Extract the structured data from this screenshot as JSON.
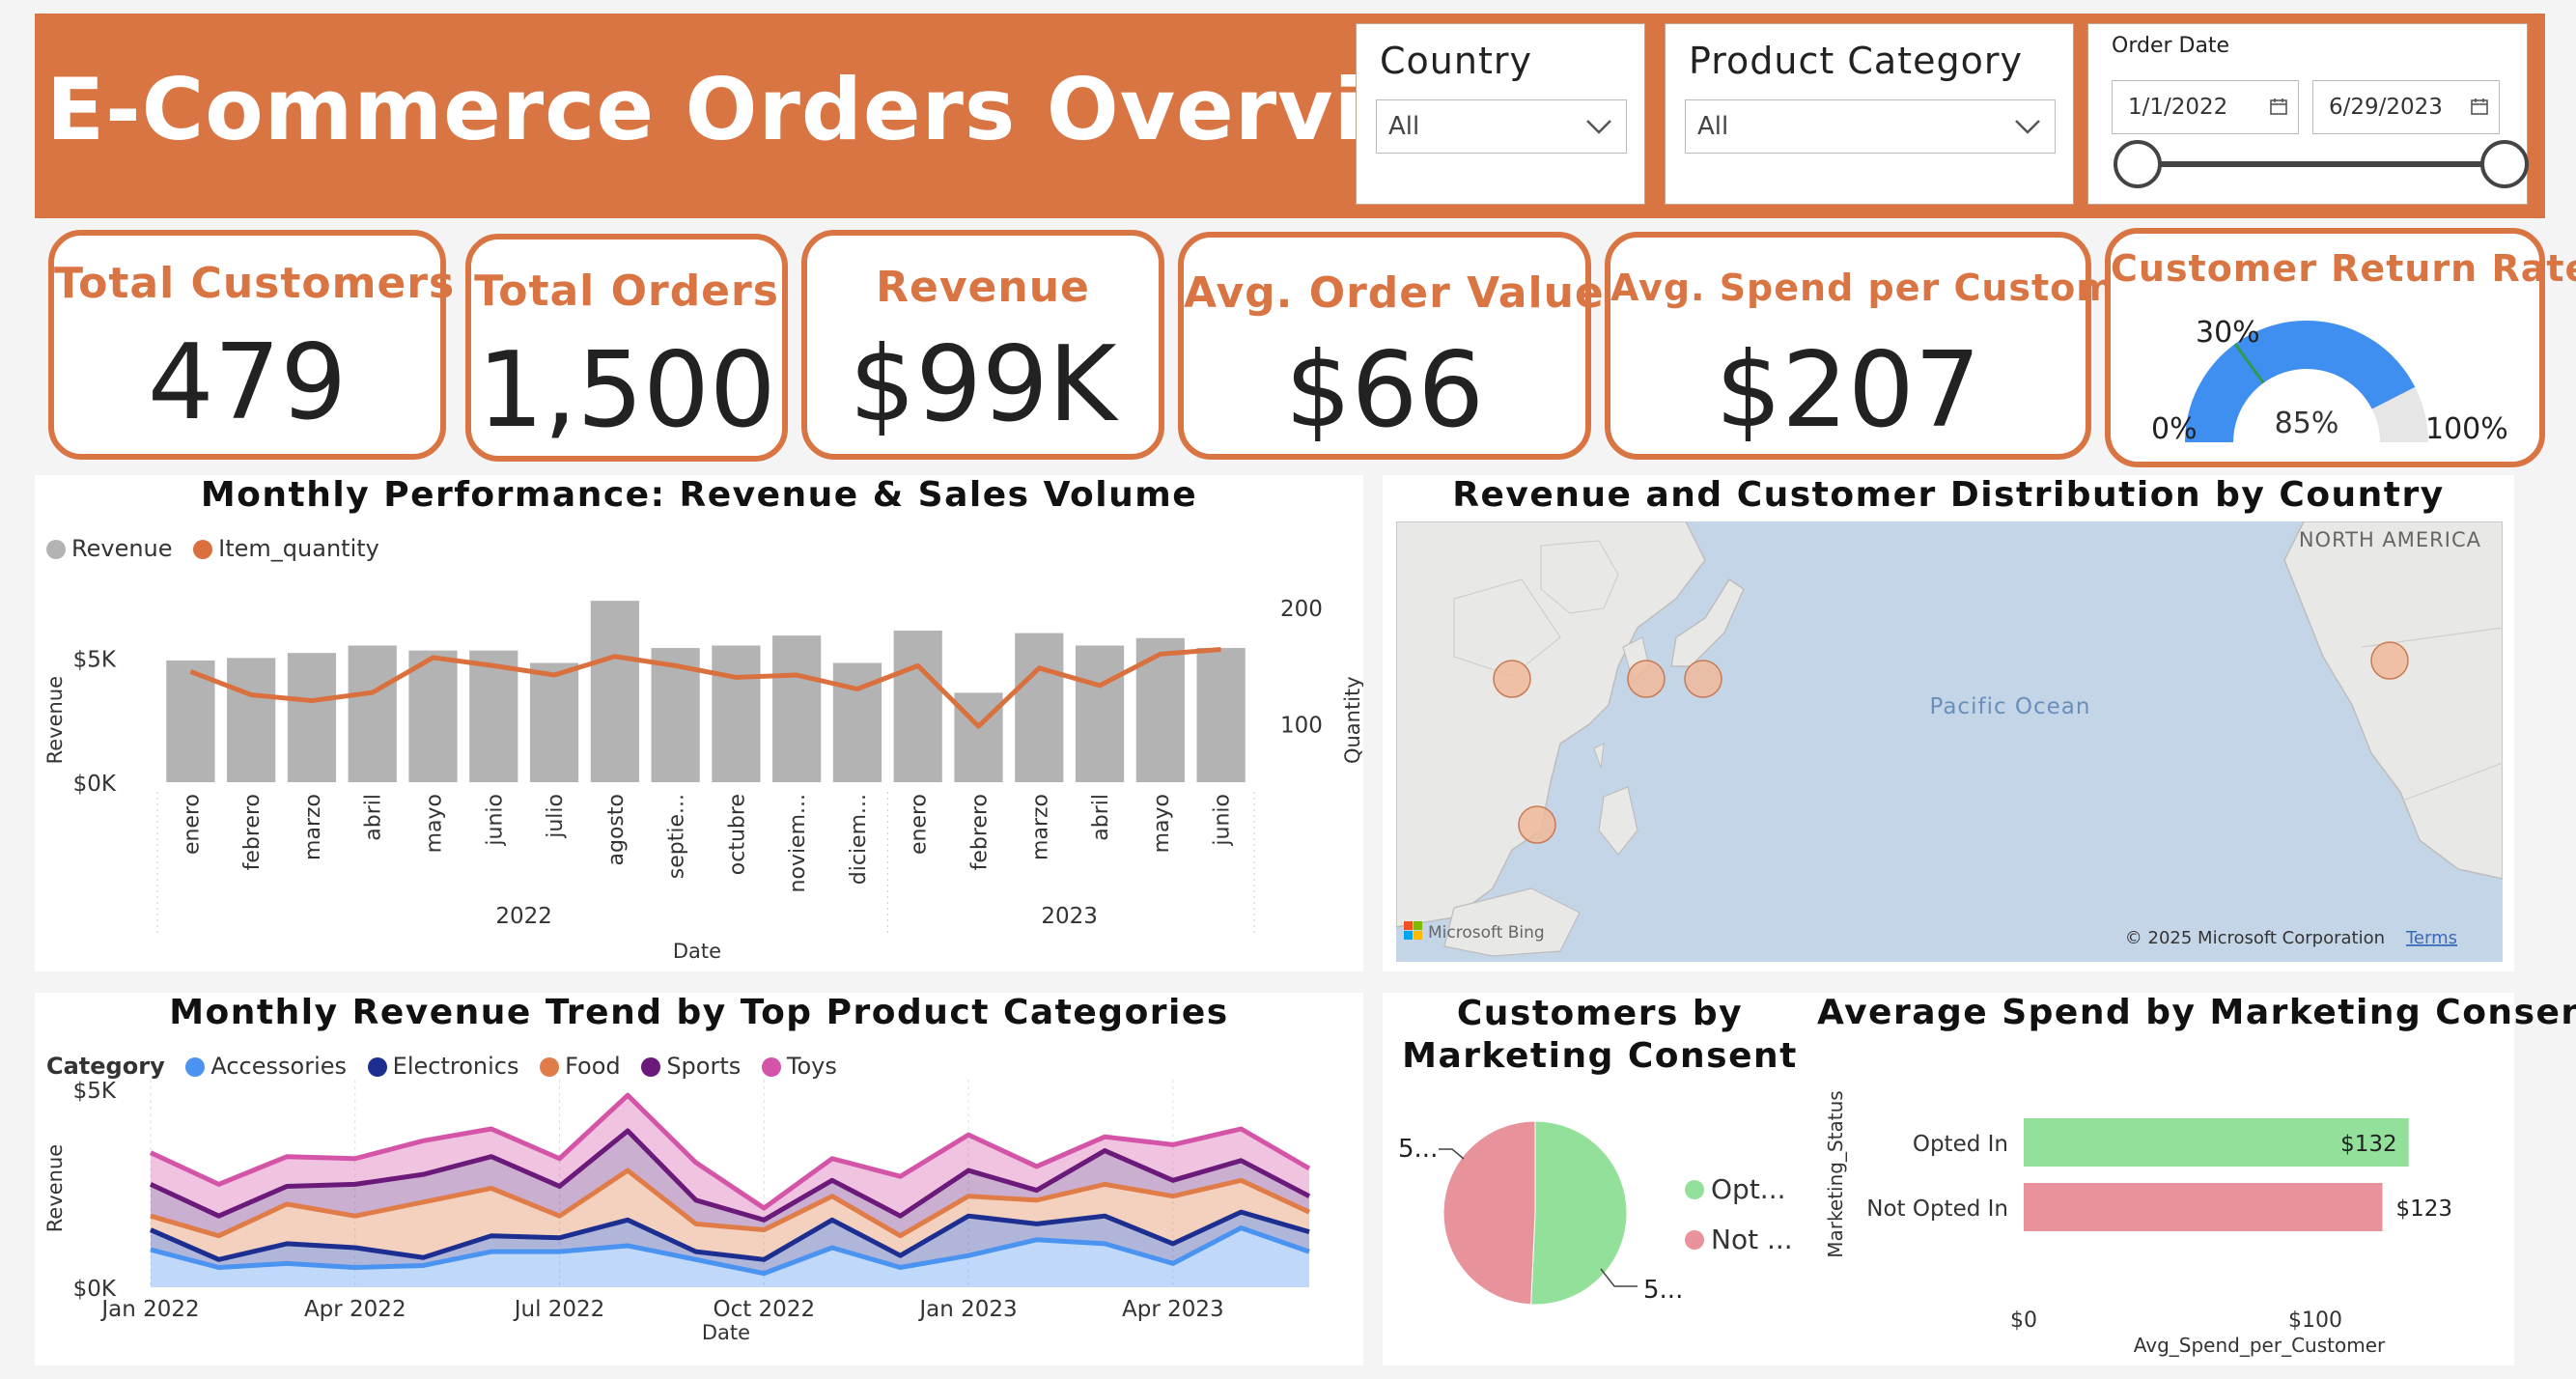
{
  "header": {
    "title": "E-Commerce Orders Overview",
    "country": {
      "label": "Country",
      "value": "All"
    },
    "category": {
      "label": "Product Category",
      "value": "All"
    },
    "order_date": {
      "label": "Order Date",
      "start": "1/1/2022",
      "end": "6/29/2023",
      "slider_start": 0,
      "slider_end": 1
    }
  },
  "kpis": {
    "customers": {
      "label": "Total Customers",
      "value": "479"
    },
    "orders": {
      "label": "Total Orders",
      "value": "1,500"
    },
    "revenue": {
      "label": "Revenue",
      "value": "$99K"
    },
    "aov": {
      "label": "Avg. Order Value",
      "value": "$66"
    },
    "spend": {
      "label": "Avg. Spend per Customer",
      "value": "$207"
    },
    "return_rate": {
      "label": "Customer Return Rate",
      "value": "85%",
      "min": "0%",
      "max": "100%",
      "target_label": "30%",
      "value_num": 85,
      "target_num": 30
    }
  },
  "colors": {
    "accent": "#d97443",
    "bar": "#b3b3b3",
    "line": "#d9703e",
    "accessories": "#4b93f0",
    "electronics": "#1d2e91",
    "food": "#e07c47",
    "sports": "#6b1a7a",
    "toys": "#d454a8",
    "opted_in": "#93e09a",
    "not_opted_in": "#e8929c",
    "gauge": "#3f8ff0",
    "map_water": "#c5d5e8",
    "map_land": "#eaeaea",
    "bubble": "#f0b89a"
  },
  "monthly_perf": {
    "title": "Monthly Performance: Revenue & Sales Volume",
    "legend": [
      "Revenue",
      "Item_quantity"
    ],
    "y_left_label": "Revenue",
    "y_right_label": "Quantity",
    "x_label": "Date",
    "y_left_ticks": [
      "$0K",
      "$5K"
    ],
    "y_right_ticks": [
      "100",
      "200"
    ],
    "years": [
      "2022",
      "2023"
    ]
  },
  "chart_data": [
    {
      "type": "bar",
      "title": "Monthly Performance: Revenue & Sales Volume",
      "xlabel": "Date",
      "ylabel": "Revenue",
      "y2label": "Quantity",
      "categories": [
        "enero",
        "febrero",
        "marzo",
        "abril",
        "mayo",
        "junio",
        "julio",
        "agosto",
        "septie...",
        "octubre",
        "noviem...",
        "diciem...",
        "enero",
        "febrero",
        "marzo",
        "abril",
        "mayo",
        "junio"
      ],
      "series": [
        {
          "name": "Revenue",
          "type": "bar",
          "values": [
            4900,
            5000,
            5200,
            5500,
            5300,
            5300,
            4800,
            7300,
            5400,
            5500,
            5900,
            4800,
            6100,
            3600,
            6000,
            5500,
            5800,
            5400
          ]
        },
        {
          "name": "Item_quantity",
          "type": "line",
          "axis": "right",
          "values": [
            145,
            125,
            120,
            127,
            157,
            150,
            142,
            158,
            150,
            140,
            142,
            130,
            150,
            98,
            148,
            133,
            160,
            164
          ]
        }
      ],
      "ylim": [
        0,
        7500
      ],
      "y2lim": [
        50,
        210
      ]
    },
    {
      "type": "area",
      "title": "Monthly Revenue Trend by Top Product Categories",
      "xlabel": "Date",
      "ylabel": "Revenue",
      "x_ticks": [
        "Jan 2022",
        "Apr 2022",
        "Jul 2022",
        "Oct 2022",
        "Jan 2023",
        "Apr 2023"
      ],
      "y_ticks": [
        "$0K",
        "$5K"
      ],
      "legend_title": "Category",
      "stacked": true,
      "x_count": 18,
      "series": [
        {
          "name": "Accessories",
          "values": [
            950,
            500,
            600,
            500,
            550,
            900,
            900,
            1050,
            700,
            350,
            1000,
            500,
            800,
            1200,
            1100,
            600,
            1500,
            900
          ]
        },
        {
          "name": "Electronics",
          "values": [
            500,
            200,
            500,
            500,
            200,
            400,
            350,
            650,
            200,
            350,
            700,
            300,
            1000,
            400,
            700,
            500,
            400,
            500
          ]
        },
        {
          "name": "Food",
          "values": [
            350,
            600,
            1000,
            800,
            1400,
            1200,
            550,
            1250,
            700,
            750,
            600,
            500,
            500,
            600,
            800,
            1200,
            800,
            500
          ]
        },
        {
          "name": "Sports",
          "values": [
            800,
            500,
            450,
            800,
            700,
            800,
            750,
            1000,
            600,
            250,
            400,
            500,
            650,
            250,
            850,
            400,
            500,
            400
          ]
        },
        {
          "name": "Toys",
          "values": [
            800,
            800,
            750,
            650,
            850,
            700,
            700,
            900,
            950,
            300,
            550,
            1000,
            900,
            600,
            350,
            900,
            800,
            700
          ]
        }
      ],
      "ylim": [
        0,
        5000
      ]
    },
    {
      "type": "pie",
      "title": "Customers by Marketing Consent",
      "labels": [
        "Opt...",
        "Not ..."
      ],
      "slice_labels": [
        "5...",
        "5..."
      ],
      "values": [
        243,
        236
      ]
    },
    {
      "type": "bar",
      "orientation": "horizontal",
      "title": "Average Spend by Marketing Consent",
      "xlabel": "Avg_Spend_per_Customer",
      "ylabel": "Marketing_Status",
      "categories": [
        "Opted In",
        "Not Opted In"
      ],
      "values": [
        132,
        123
      ],
      "value_labels": [
        "$132",
        "$123"
      ],
      "x_ticks": [
        "$0",
        "$100"
      ],
      "xlim": [
        0,
        160
      ]
    }
  ],
  "map": {
    "title": "Revenue and Customer Distribution by Country",
    "continent_label": "NORTH AMERICA",
    "ocean_label": "Pacific Ocean",
    "provider": "Microsoft Bing",
    "copyright": "© 2025 Microsoft Corporation",
    "terms": "Terms"
  },
  "trend": {
    "title": "Monthly Revenue Trend by Top Product Categories",
    "legend_title": "Category",
    "legend": [
      "Accessories",
      "Electronics",
      "Food",
      "Sports",
      "Toys"
    ]
  },
  "pie": {
    "title_line1": "Customers by",
    "title_line2": "Marketing Consent"
  },
  "hbar": {
    "title": "Average Spend by Marketing Consent"
  }
}
